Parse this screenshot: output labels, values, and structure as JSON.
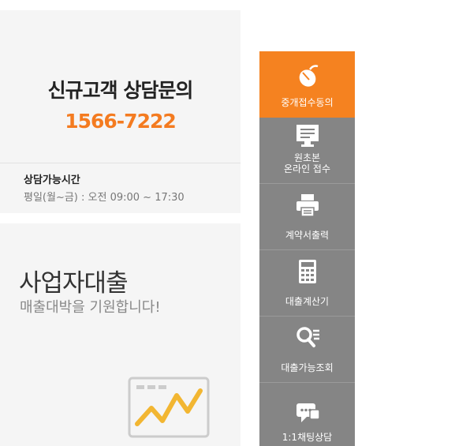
{
  "consult_card": {
    "title": "신규고객 상담문의",
    "phone": "1566-7222",
    "hours_label": "상담가능시간",
    "hours_value": "평일(월~금) : 오전 09:00 ~ 17:30"
  },
  "loan_card": {
    "title": "사업자대출",
    "subtitle": "매출대박을 기원합니다!"
  },
  "quick_menu": {
    "items": [
      {
        "label": "중개접수동의",
        "icon": "mouse-icon",
        "active": true
      },
      {
        "label": "원초본",
        "label2": "온라인 접수",
        "icon": "monitor-icon"
      },
      {
        "label": "계약서출력",
        "icon": "printer-icon"
      },
      {
        "label": "대출계산기",
        "icon": "calculator-icon"
      },
      {
        "label": "대출가능조회",
        "icon": "search-list-icon"
      },
      {
        "label": "1:1채팅상담",
        "icon": "chat-icon"
      }
    ]
  },
  "colors": {
    "accent": "#f58220",
    "phone": "#f47b20",
    "menu_bg": "#858585",
    "card_bg": "#f5f5f5"
  }
}
